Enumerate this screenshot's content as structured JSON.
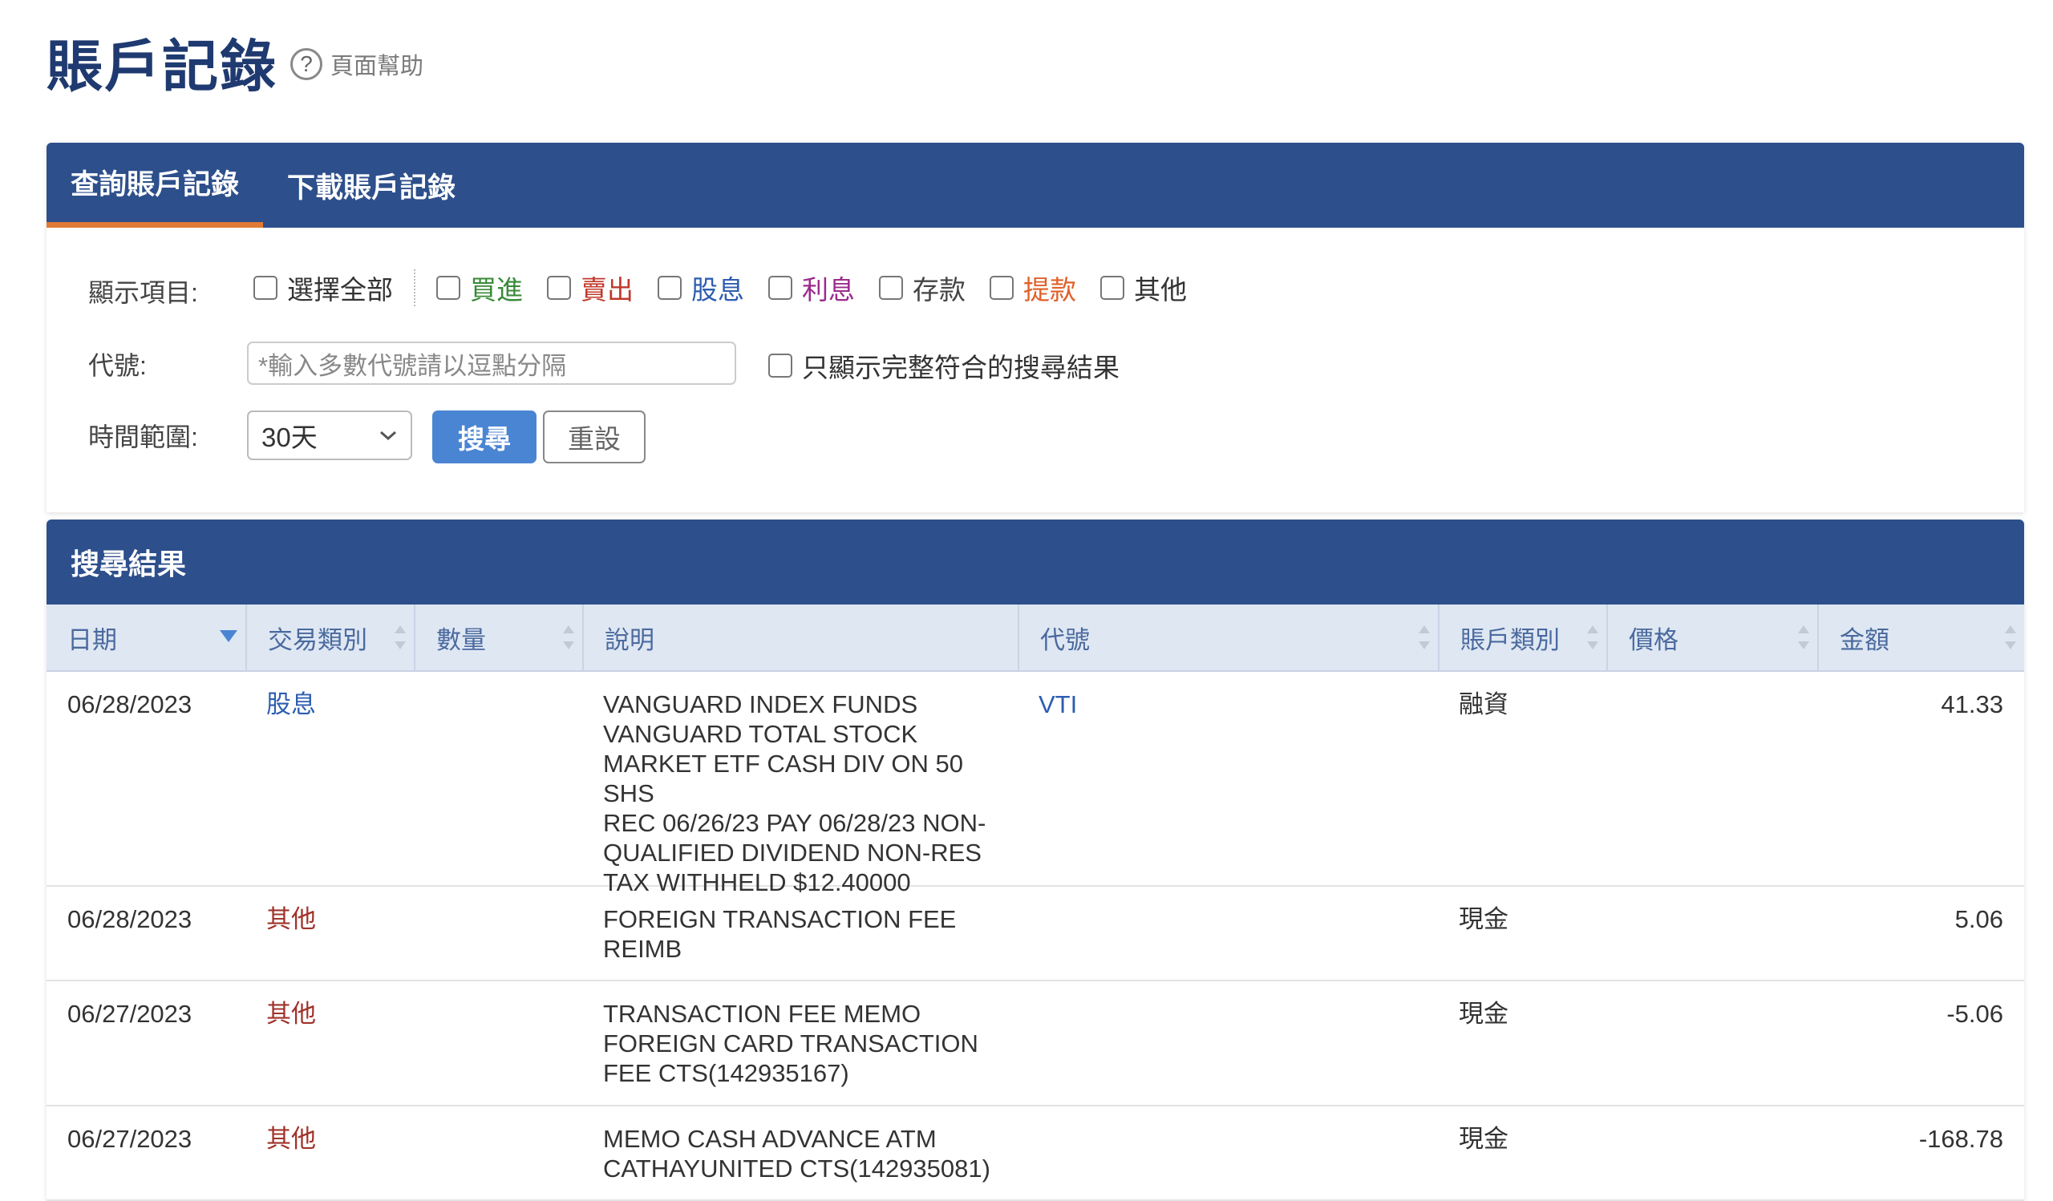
{
  "page": {
    "title": "賬戶記錄",
    "help_label": "頁面幫助",
    "help_glyph": "?"
  },
  "tabs": [
    {
      "label": "查詢賬戶記錄",
      "active": true
    },
    {
      "label": "下載賬戶記錄",
      "active": false
    }
  ],
  "filters": {
    "display_label": "顯示項目:",
    "checkboxes": [
      {
        "label": "選擇全部",
        "color": "#333333"
      },
      {
        "label": "買進",
        "color": "#3a8a3a"
      },
      {
        "label": "賣出",
        "color": "#c0392b"
      },
      {
        "label": "股息",
        "color": "#2d5db0"
      },
      {
        "label": "利息",
        "color": "#9b2a8c"
      },
      {
        "label": "存款",
        "color": "#444444"
      },
      {
        "label": "提款",
        "color": "#e0602a"
      },
      {
        "label": "其他",
        "color": "#333333"
      }
    ],
    "code_label": "代號:",
    "code_placeholder": "*輸入多數代號請以逗點分隔",
    "exact_match_label": "只顯示完整符合的搜尋結果",
    "range_label": "時間範圍:",
    "range_value": "30天",
    "search_button": "搜尋",
    "reset_button": "重設"
  },
  "results": {
    "title": "搜尋結果",
    "columns": [
      "日期",
      "交易類別",
      "數量",
      "說明",
      "代號",
      "賬戶類別",
      "價格",
      "金額"
    ],
    "rows": [
      {
        "date": "06/28/2023",
        "type": "股息",
        "type_color": "#2d5db0",
        "qty": "",
        "desc": [
          "VANGUARD INDEX FUNDS",
          "VANGUARD TOTAL STOCK",
          "MARKET ETF CASH DIV ON 50 SHS",
          "REC 06/26/23 PAY 06/28/23 NON-",
          "QUALIFIED DIVIDEND NON-RES",
          "TAX WITHHELD $12.40000"
        ],
        "symbol": "VTI",
        "account": "融資",
        "price": "",
        "amount": "41.33"
      },
      {
        "date": "06/28/2023",
        "type": "其他",
        "type_color": "#a0332a",
        "qty": "",
        "desc": [
          "FOREIGN TRANSACTION FEE",
          "REIMB"
        ],
        "symbol": "",
        "account": "現金",
        "price": "",
        "amount": "5.06"
      },
      {
        "date": "06/27/2023",
        "type": "其他",
        "type_color": "#a0332a",
        "qty": "",
        "desc": [
          "TRANSACTION FEE MEMO",
          "FOREIGN CARD TRANSACTION",
          "FEE CTS(142935167)"
        ],
        "symbol": "",
        "account": "現金",
        "price": "",
        "amount": "-5.06"
      },
      {
        "date": "06/27/2023",
        "type": "其他",
        "type_color": "#a0332a",
        "qty": "",
        "desc": [
          "MEMO CASH ADVANCE ATM",
          "CATHAYUNITED CTS(142935081)"
        ],
        "symbol": "",
        "account": "現金",
        "price": "",
        "amount": "-168.78"
      }
    ]
  },
  "colors": {
    "header_bg": "#2d4f8b",
    "tab_underline": "#e07a35",
    "primary_button": "#4a85d3",
    "title": "#1f3a70"
  }
}
